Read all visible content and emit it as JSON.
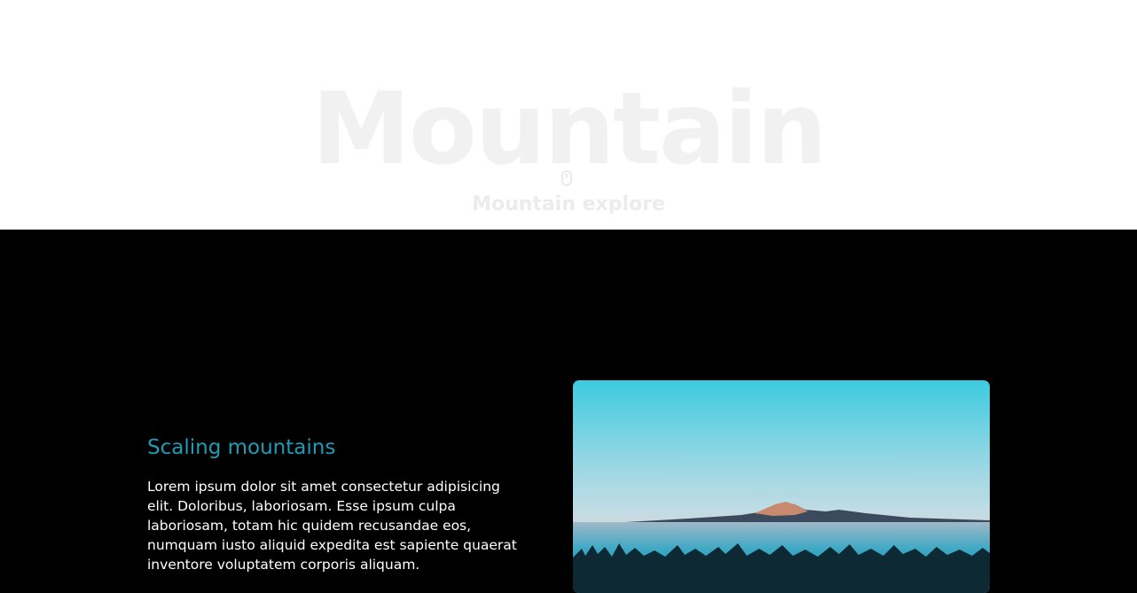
{
  "hero": {
    "title": "Mountain",
    "subtitle": "Mountain explore",
    "scroll_icon": "mouse-icon"
  },
  "section": {
    "heading": "Scaling mountains",
    "body": "Lorem ipsum dolor sit amet consectetur adipisicing elit. Doloribus, laboriosam. Esse ipsum culpa laboriosam, totam hic quidem recusandae eos, numquam iusto aliquid expedita est sapiente quaerat inventore voluptatem corporis aliquam.",
    "heading_color": "#1e9bb5"
  },
  "colors": {
    "hero_bg": "#ffffff",
    "hero_text": "#f1f1f1",
    "content_bg": "#000000",
    "body_text": "#ffffff"
  }
}
